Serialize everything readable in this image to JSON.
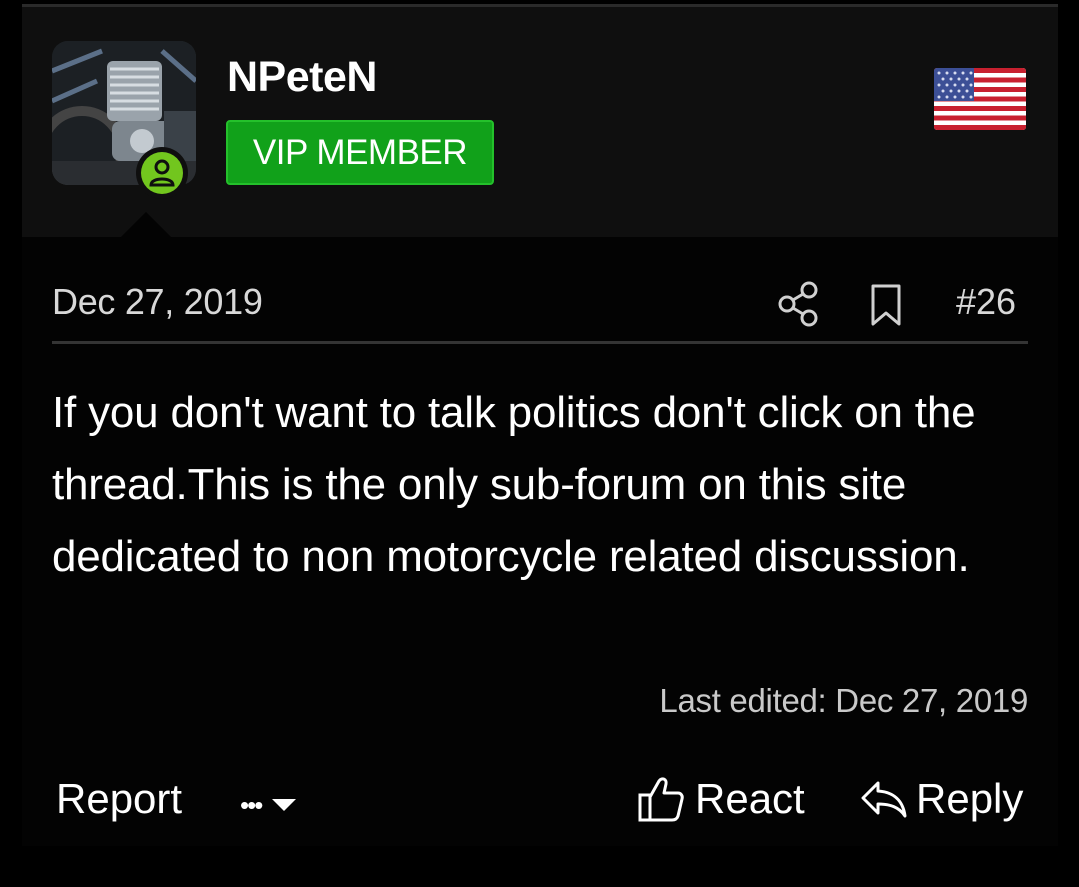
{
  "user": {
    "username": "NPeteN",
    "badge": "VIP MEMBER",
    "online": true,
    "country_flag": "usa-flag-icon"
  },
  "post": {
    "date": "Dec 27, 2019",
    "number": "#26",
    "body": "If you don't want to talk politics don't click on the thread.This is the only sub-forum on this site dedicated to non motorcycle related discussion.",
    "last_edited": "Last edited: Dec 27, 2019"
  },
  "actions": {
    "report": "Report",
    "more": "•••",
    "react": "React",
    "reply": "Reply"
  },
  "colors": {
    "badge_green": "#11a11a",
    "online_green": "#72c61e",
    "background": "#000000"
  }
}
